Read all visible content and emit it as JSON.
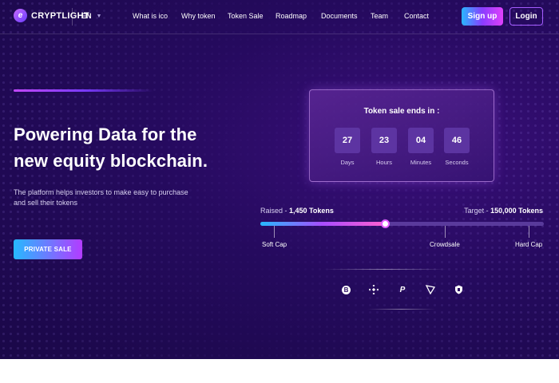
{
  "brand": {
    "name": "CRYPTLIGHT",
    "logo_icon": "e-logo-icon"
  },
  "language": {
    "current": "EN"
  },
  "nav": {
    "links": [
      "What is ico",
      "Why token",
      "Token Sale",
      "Roadmap",
      "Documents",
      "Team",
      "Contact"
    ],
    "signup_label": "Sign up",
    "login_label": "Login"
  },
  "hero": {
    "headline_line1": "Powering Data for the",
    "headline_line2": "new equity blockchain.",
    "subtext_line1": "The platform helps investors to make easy to purchase",
    "subtext_line2": "and sell their tokens",
    "cta_label": "PRIVATE SALE"
  },
  "countdown": {
    "title": "Token sale ends in :",
    "units": [
      {
        "value": "27",
        "label": "Days"
      },
      {
        "value": "23",
        "label": "Hours"
      },
      {
        "value": "04",
        "label": "Minutes"
      },
      {
        "value": "46",
        "label": "Seconds"
      }
    ]
  },
  "token_progress": {
    "raised_label": "Raised -",
    "raised_value": "1,450 Tokens",
    "target_label": "Target -",
    "target_value": "150,000 Tokens",
    "progress_fraction": 0.44,
    "milestones": [
      "Soft Cap",
      "Crowdsale",
      "Hard Cap"
    ]
  },
  "payment_icons": [
    "bitcoin-icon",
    "binance-icon",
    "paypal-icon",
    "tron-icon",
    "shield-coin-icon"
  ],
  "colors": {
    "background": "#250a5e",
    "accent_gradient_start": "#26b9ff",
    "accent_gradient_end": "#b33cff",
    "login_border": "#a55cff"
  }
}
